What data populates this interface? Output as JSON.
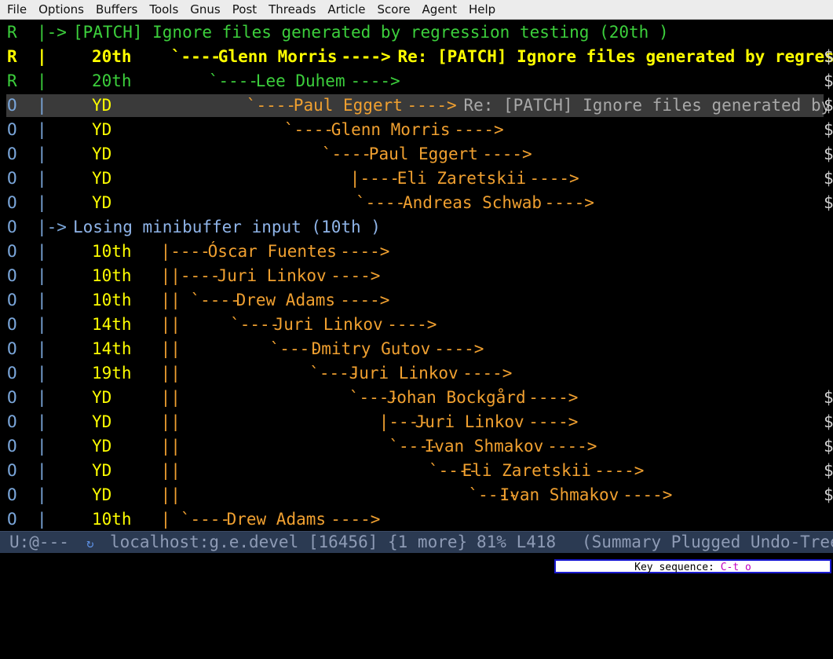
{
  "menu": [
    "File",
    "Options",
    "Buffers",
    "Tools",
    "Gnus",
    "Post",
    "Threads",
    "Article",
    "Score",
    "Agent",
    "Help"
  ],
  "summary_lines": [
    {
      "mark": "R",
      "bar": "|->",
      "date": "",
      "thread": "",
      "from": "",
      "arrow": "",
      "subject": "[PATCH] Ignore files generated by regression testing (20th )",
      "dollar": "",
      "style": "root-green"
    },
    {
      "mark": "R",
      "bar": "|",
      "date": "20th",
      "thread": "`----",
      "from": "Glenn Morris",
      "arrow": " ---->",
      "subject": " Re: [PATCH] Ignore files generated by regress",
      "dollar": "$",
      "style": "bold-yellow"
    },
    {
      "mark": "R",
      "bar": "|",
      "date": "20th",
      "thread": "`----",
      "from": "Lee Duhem",
      "arrow": " ---->",
      "subject": "",
      "dollar": "$",
      "style": "green"
    },
    {
      "mark": "O",
      "bar": "|",
      "date": "YD",
      "thread": "`----",
      "from": "Paul Eggert",
      "arrow": " ---->",
      "subject": " Re: [PATCH] Ignore files generated by",
      "dollar": "$",
      "style": "current"
    },
    {
      "mark": "O",
      "bar": "|",
      "date": "YD",
      "thread": "`----",
      "from": "Glenn Morris",
      "arrow": " ---->",
      "subject": "",
      "dollar": "$",
      "style": "unread"
    },
    {
      "mark": "O",
      "bar": "|",
      "date": "YD",
      "thread": "`----",
      "from": "Paul Eggert",
      "arrow": " ---->",
      "subject": "",
      "dollar": "$",
      "style": "unread"
    },
    {
      "mark": "O",
      "bar": "|",
      "date": "YD",
      "thread": "|----",
      "from": "Eli Zaretskii",
      "arrow": " ---->",
      "subject": "",
      "dollar": "$",
      "style": "unread"
    },
    {
      "mark": "O",
      "bar": "|",
      "date": "YD",
      "thread": "`----",
      "from": "Andreas Schwab",
      "arrow": " ---->",
      "subject": "",
      "dollar": "$",
      "style": "unread"
    },
    {
      "mark": "O",
      "bar": "|->",
      "date": "",
      "thread": "",
      "from": "",
      "arrow": "",
      "subject": "Losing minibuffer input (10th )",
      "dollar": "",
      "style": "root-blue"
    },
    {
      "mark": "O",
      "bar": "|",
      "date": "10th",
      "thread": "|----",
      "from": "Óscar Fuentes",
      "arrow": " ---->",
      "subject": "",
      "dollar": "",
      "style": "unread"
    },
    {
      "mark": "O",
      "bar": "|",
      "date": "10th",
      "thread": "||----",
      "from": "Juri Linkov",
      "arrow": " ---->",
      "subject": "",
      "dollar": "",
      "style": "unread"
    },
    {
      "mark": "O",
      "bar": "|",
      "date": "10th",
      "thread": "|| `----",
      "from": "Drew Adams",
      "arrow": " ---->",
      "subject": "",
      "dollar": "",
      "style": "unread"
    },
    {
      "mark": "O",
      "bar": "|",
      "date": "14th",
      "thread": "||     `----",
      "from": "Juri Linkov",
      "arrow": " ---->",
      "subject": "",
      "dollar": "",
      "style": "unread"
    },
    {
      "mark": "O",
      "bar": "|",
      "date": "14th",
      "thread": "||         `----",
      "from": "Dmitry Gutov",
      "arrow": " ---->",
      "subject": "",
      "dollar": "",
      "style": "unread"
    },
    {
      "mark": "O",
      "bar": "|",
      "date": "19th",
      "thread": "||             `----",
      "from": "Juri Linkov",
      "arrow": " ---->",
      "subject": "",
      "dollar": "",
      "style": "unread"
    },
    {
      "mark": "O",
      "bar": "|",
      "date": "YD",
      "thread": "||                 `----",
      "from": "Johan Bockgård",
      "arrow": " ---->",
      "subject": "",
      "dollar": "$",
      "style": "unread"
    },
    {
      "mark": "O",
      "bar": "|",
      "date": "YD",
      "thread": "||                    |----",
      "from": "Juri Linkov",
      "arrow": " ---->",
      "subject": "",
      "dollar": "$",
      "style": "unread"
    },
    {
      "mark": "O",
      "bar": "|",
      "date": "YD",
      "thread": "||                     `----",
      "from": "Ivan Shmakov",
      "arrow": " ---->",
      "subject": "",
      "dollar": "$",
      "style": "unread"
    },
    {
      "mark": "O",
      "bar": "|",
      "date": "YD",
      "thread": "||                         `----",
      "from": "Eli Zaretskii",
      "arrow": " ---->",
      "subject": "",
      "dollar": "$",
      "style": "unread"
    },
    {
      "mark": "O",
      "bar": "|",
      "date": "YD",
      "thread": "||                             `----",
      "from": "Ivan Shmakov",
      "arrow": " ---->",
      "subject": "",
      "dollar": "$",
      "style": "unread"
    },
    {
      "mark": "O",
      "bar": "|",
      "date": "10th",
      "thread": "| `----",
      "from": "Drew Adams",
      "arrow": " ---->",
      "subject": "",
      "dollar": "",
      "style": "unread"
    }
  ],
  "modeline": {
    "status": "U:@---",
    "icon": "network-icon",
    "buffer": "localhost:g.e.devel [16456] {1 more}",
    "position": "81% L418",
    "modes": "(Summary Plugged Undo-Tree"
  },
  "echo": {
    "label": "Key sequence:",
    "keys": "C-t o"
  }
}
